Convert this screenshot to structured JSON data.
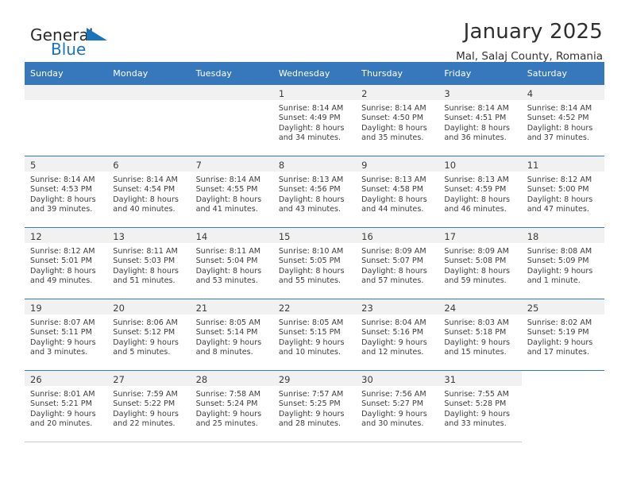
{
  "brand": {
    "name_top": "General",
    "name_bottom": "Blue",
    "accent_color": "#1a74bb"
  },
  "header": {
    "title": "January 2025",
    "subtitle": "Mal, Salaj County, Romania"
  },
  "calendar": {
    "header_bg": "#3778bd",
    "daynum_bg": "#f1f1f1",
    "weekday_headers": [
      "Sunday",
      "Monday",
      "Tuesday",
      "Wednesday",
      "Thursday",
      "Friday",
      "Saturday"
    ],
    "weeks": [
      [
        {
          "day": "",
          "lines": []
        },
        {
          "day": "",
          "lines": []
        },
        {
          "day": "",
          "lines": []
        },
        {
          "day": "1",
          "lines": [
            "Sunrise: 8:14 AM",
            "Sunset: 4:49 PM",
            "Daylight: 8 hours",
            "and 34 minutes."
          ]
        },
        {
          "day": "2",
          "lines": [
            "Sunrise: 8:14 AM",
            "Sunset: 4:50 PM",
            "Daylight: 8 hours",
            "and 35 minutes."
          ]
        },
        {
          "day": "3",
          "lines": [
            "Sunrise: 8:14 AM",
            "Sunset: 4:51 PM",
            "Daylight: 8 hours",
            "and 36 minutes."
          ]
        },
        {
          "day": "4",
          "lines": [
            "Sunrise: 8:14 AM",
            "Sunset: 4:52 PM",
            "Daylight: 8 hours",
            "and 37 minutes."
          ]
        }
      ],
      [
        {
          "day": "5",
          "lines": [
            "Sunrise: 8:14 AM",
            "Sunset: 4:53 PM",
            "Daylight: 8 hours",
            "and 39 minutes."
          ]
        },
        {
          "day": "6",
          "lines": [
            "Sunrise: 8:14 AM",
            "Sunset: 4:54 PM",
            "Daylight: 8 hours",
            "and 40 minutes."
          ]
        },
        {
          "day": "7",
          "lines": [
            "Sunrise: 8:14 AM",
            "Sunset: 4:55 PM",
            "Daylight: 8 hours",
            "and 41 minutes."
          ]
        },
        {
          "day": "8",
          "lines": [
            "Sunrise: 8:13 AM",
            "Sunset: 4:56 PM",
            "Daylight: 8 hours",
            "and 43 minutes."
          ]
        },
        {
          "day": "9",
          "lines": [
            "Sunrise: 8:13 AM",
            "Sunset: 4:58 PM",
            "Daylight: 8 hours",
            "and 44 minutes."
          ]
        },
        {
          "day": "10",
          "lines": [
            "Sunrise: 8:13 AM",
            "Sunset: 4:59 PM",
            "Daylight: 8 hours",
            "and 46 minutes."
          ]
        },
        {
          "day": "11",
          "lines": [
            "Sunrise: 8:12 AM",
            "Sunset: 5:00 PM",
            "Daylight: 8 hours",
            "and 47 minutes."
          ]
        }
      ],
      [
        {
          "day": "12",
          "lines": [
            "Sunrise: 8:12 AM",
            "Sunset: 5:01 PM",
            "Daylight: 8 hours",
            "and 49 minutes."
          ]
        },
        {
          "day": "13",
          "lines": [
            "Sunrise: 8:11 AM",
            "Sunset: 5:03 PM",
            "Daylight: 8 hours",
            "and 51 minutes."
          ]
        },
        {
          "day": "14",
          "lines": [
            "Sunrise: 8:11 AM",
            "Sunset: 5:04 PM",
            "Daylight: 8 hours",
            "and 53 minutes."
          ]
        },
        {
          "day": "15",
          "lines": [
            "Sunrise: 8:10 AM",
            "Sunset: 5:05 PM",
            "Daylight: 8 hours",
            "and 55 minutes."
          ]
        },
        {
          "day": "16",
          "lines": [
            "Sunrise: 8:09 AM",
            "Sunset: 5:07 PM",
            "Daylight: 8 hours",
            "and 57 minutes."
          ]
        },
        {
          "day": "17",
          "lines": [
            "Sunrise: 8:09 AM",
            "Sunset: 5:08 PM",
            "Daylight: 8 hours",
            "and 59 minutes."
          ]
        },
        {
          "day": "18",
          "lines": [
            "Sunrise: 8:08 AM",
            "Sunset: 5:09 PM",
            "Daylight: 9 hours",
            "and 1 minute."
          ]
        }
      ],
      [
        {
          "day": "19",
          "lines": [
            "Sunrise: 8:07 AM",
            "Sunset: 5:11 PM",
            "Daylight: 9 hours",
            "and 3 minutes."
          ]
        },
        {
          "day": "20",
          "lines": [
            "Sunrise: 8:06 AM",
            "Sunset: 5:12 PM",
            "Daylight: 9 hours",
            "and 5 minutes."
          ]
        },
        {
          "day": "21",
          "lines": [
            "Sunrise: 8:05 AM",
            "Sunset: 5:14 PM",
            "Daylight: 9 hours",
            "and 8 minutes."
          ]
        },
        {
          "day": "22",
          "lines": [
            "Sunrise: 8:05 AM",
            "Sunset: 5:15 PM",
            "Daylight: 9 hours",
            "and 10 minutes."
          ]
        },
        {
          "day": "23",
          "lines": [
            "Sunrise: 8:04 AM",
            "Sunset: 5:16 PM",
            "Daylight: 9 hours",
            "and 12 minutes."
          ]
        },
        {
          "day": "24",
          "lines": [
            "Sunrise: 8:03 AM",
            "Sunset: 5:18 PM",
            "Daylight: 9 hours",
            "and 15 minutes."
          ]
        },
        {
          "day": "25",
          "lines": [
            "Sunrise: 8:02 AM",
            "Sunset: 5:19 PM",
            "Daylight: 9 hours",
            "and 17 minutes."
          ]
        }
      ],
      [
        {
          "day": "26",
          "lines": [
            "Sunrise: 8:01 AM",
            "Sunset: 5:21 PM",
            "Daylight: 9 hours",
            "and 20 minutes."
          ]
        },
        {
          "day": "27",
          "lines": [
            "Sunrise: 7:59 AM",
            "Sunset: 5:22 PM",
            "Daylight: 9 hours",
            "and 22 minutes."
          ]
        },
        {
          "day": "28",
          "lines": [
            "Sunrise: 7:58 AM",
            "Sunset: 5:24 PM",
            "Daylight: 9 hours",
            "and 25 minutes."
          ]
        },
        {
          "day": "29",
          "lines": [
            "Sunrise: 7:57 AM",
            "Sunset: 5:25 PM",
            "Daylight: 9 hours",
            "and 28 minutes."
          ]
        },
        {
          "day": "30",
          "lines": [
            "Sunrise: 7:56 AM",
            "Sunset: 5:27 PM",
            "Daylight: 9 hours",
            "and 30 minutes."
          ]
        },
        {
          "day": "31",
          "lines": [
            "Sunrise: 7:55 AM",
            "Sunset: 5:28 PM",
            "Daylight: 9 hours",
            "and 33 minutes."
          ]
        }
      ]
    ]
  }
}
